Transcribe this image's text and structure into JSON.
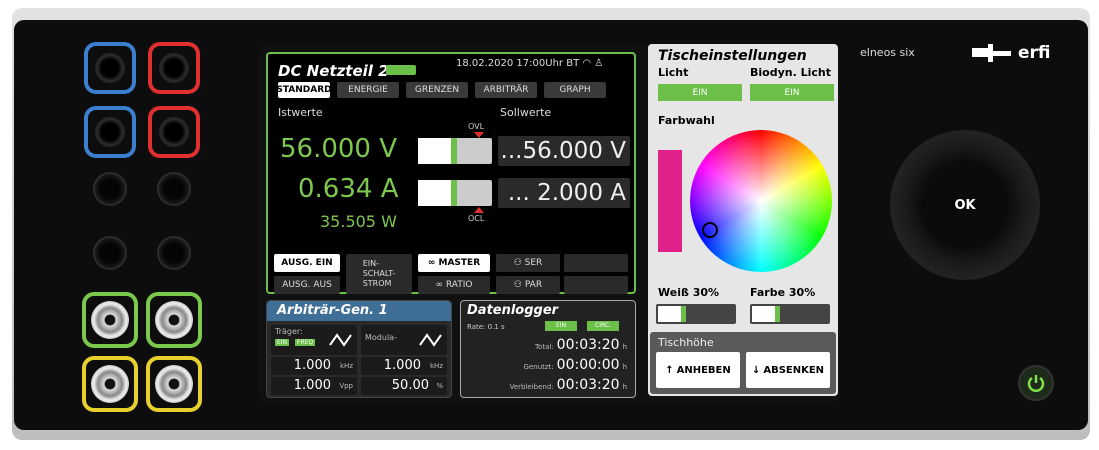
{
  "device": {
    "brand": "erfi",
    "model": "elneos six",
    "knob_label": "OK"
  },
  "dc": {
    "title": "DC Netzteil 2",
    "datetime": "18.02.2020  17:00Uhr",
    "bt": "BT",
    "tabs": [
      "STANDARD",
      "ENERGIE",
      "GRENZEN",
      "ARBITRÄR",
      "GRAPH"
    ],
    "active_tab": "STANDARD",
    "istwerte_label": "Istwerte",
    "sollwerte_label": "Sollwerte",
    "voltage_actual": "56.000 V",
    "current_actual": "0.634 A",
    "power_actual": "35.505 W",
    "voltage_set": "...56.000 V",
    "current_set": "... 2.000 A",
    "ovl_label": "OVL",
    "ocl_label": "OCL",
    "voltage_slider_fraction": 0.45,
    "current_slider_fraction": 0.45,
    "out_on": "AUSG. EIN",
    "out_off": "AUSG. AUS",
    "switch_current": "EIN-\nSCHALT-\nSTROM",
    "master": "MASTER",
    "ratio": "RATIO",
    "ser": "SER",
    "par": "PAR"
  },
  "arb": {
    "title": "Arbiträr-Gen. 1",
    "carrier_label": "Träger:",
    "carrier_tags": [
      "EIN",
      "FREQ"
    ],
    "mod_label": "Modula-",
    "freq1": "1.000",
    "freq1_unit": "kHz",
    "freq2": "1.000",
    "freq2_unit": "kHz",
    "amplitude": "1.000",
    "amplitude_unit": "Vpp",
    "duty": "50.00",
    "duty_unit": "%"
  },
  "logger": {
    "title": "Datenlogger",
    "rate": "Rate: 0.1 s",
    "tag_on": "EIN",
    "tag_circ": "CIRC.",
    "total_label": "Total:",
    "total_value": "00:03:20",
    "used_label": "Genutzt:",
    "used_value": "00:00:00",
    "remaining_label": "Verbleibend:",
    "remaining_value": "00:03:20",
    "unit": "h"
  },
  "table": {
    "title": "Tischeinstellungen",
    "light_label": "Licht",
    "biodyn_label": "Biodyn. Licht",
    "light_state": "EIN",
    "biodyn_state": "EIN",
    "color_label": "Farbwahl",
    "white_label": "Weiß 30%",
    "color_level_label": "Farbe 30%",
    "white_fraction": 0.3,
    "color_fraction": 0.3,
    "height_label": "Tischhöhe",
    "raise": "ANHEBEN",
    "lower": "ABSENKEN",
    "selected_color": "#e0218a"
  },
  "colors": {
    "accent_green": "#6cc04a",
    "socket_blue": "#3a7fd0",
    "socket_red": "#e03030",
    "bnc_green": "#7cc84a",
    "bnc_yellow": "#e6d12c",
    "arb_header": "#3f6e96"
  }
}
